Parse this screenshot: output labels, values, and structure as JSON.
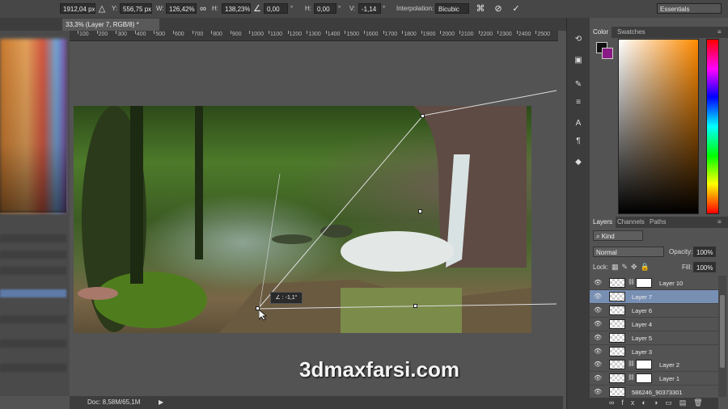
{
  "options_bar": {
    "x_value": "1912,04 px",
    "delta_icon": "delta-icon",
    "y_label": "Y:",
    "y_value": "556,75 px",
    "w_label": "W:",
    "w_value": "126,42%",
    "link_icon": "link-icon",
    "h_label": "H:",
    "h_value": "138,23%",
    "rotate_icon": "rotate-angle-icon",
    "rotate_value": "0,00",
    "deg1": "°",
    "hskew_label": "H:",
    "hskew_value": "0,00",
    "deg2": "°",
    "vskew_label": "V:",
    "vskew_value": "-1,14",
    "deg3": "°",
    "interp_label": "Interpolation:",
    "interp_value": "Bicubic",
    "warp_icon": "warp-icon",
    "cancel_icon": "cancel-icon",
    "commit_icon": "commit-check-icon",
    "workspace": "Essentials"
  },
  "document": {
    "tab_title": "33,3% (Layer 7, RGB/8) *",
    "ruler_ticks": [
      "100",
      "200",
      "300",
      "400",
      "500",
      "600",
      "700",
      "800",
      "900",
      "1000",
      "1100",
      "1200",
      "1300",
      "1400",
      "1500",
      "1600",
      "1700",
      "1800",
      "1900",
      "2000",
      "2100",
      "2200",
      "2300",
      "2400",
      "2500"
    ],
    "angle_readout": "∠ : -1,1°",
    "status": "Doc: 8,58M/65,1M"
  },
  "watermark": "3dmaxfarsi.com",
  "tools": [
    "history-icon",
    "layers-comp-icon",
    "brush-icon",
    "brush-preset-icon",
    "character-icon",
    "paragraph-icon",
    "3d-icon"
  ],
  "color_panel": {
    "tabs": [
      "Color",
      "Swatches"
    ],
    "foreground": "#111111",
    "background": "#8a1b86"
  },
  "layers_panel": {
    "tabs": [
      "Layers",
      "Channels",
      "Paths"
    ],
    "filter": "Kind",
    "blend_mode": "Normal",
    "opacity_label": "Opacity:",
    "opacity": "100%",
    "lock_label": "Lock:",
    "fill_label": "Fill:",
    "fill": "100%",
    "layers": [
      {
        "name": "Layer 10",
        "mask": true,
        "selected": false
      },
      {
        "name": "Layer 7",
        "mask": false,
        "selected": true
      },
      {
        "name": "Layer 6",
        "mask": false,
        "selected": false
      },
      {
        "name": "Layer 4",
        "mask": false,
        "selected": false
      },
      {
        "name": "Layer 5",
        "mask": false,
        "selected": false
      },
      {
        "name": "Layer 3",
        "mask": false,
        "selected": false
      },
      {
        "name": "Layer 2",
        "mask": true,
        "selected": false
      },
      {
        "name": "Layer 1",
        "mask": true,
        "selected": false
      },
      {
        "name": "586246_90373301",
        "mask": false,
        "selected": false
      }
    ]
  }
}
